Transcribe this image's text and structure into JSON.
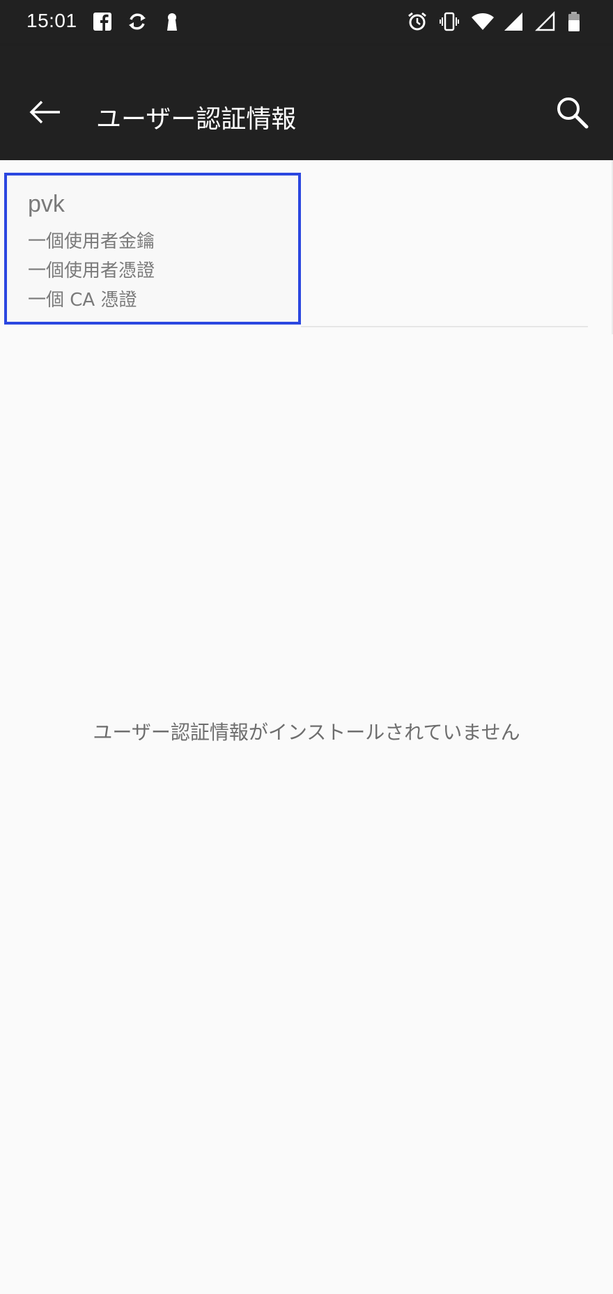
{
  "status_bar": {
    "time": "15:01",
    "left_icons": [
      "facebook-icon",
      "sync-icon",
      "keyhole-icon"
    ],
    "right_icons": [
      "alarm-icon",
      "vibrate-icon",
      "wifi-icon",
      "signal-icon",
      "signal-empty-icon",
      "battery-icon"
    ]
  },
  "app_bar": {
    "title": "ユーザー認証情報",
    "back_icon": "arrow-left-icon",
    "search_icon": "search-icon"
  },
  "credential": {
    "name": "pvk",
    "lines": [
      "一個使用者金鑰",
      "一個使用者憑證",
      "一個 CA 憑證"
    ],
    "highlight_color": "#2b47e0"
  },
  "empty_state": {
    "message": "ユーザー認証情報がインストールされていません"
  },
  "colors": {
    "bar_background": "#212121",
    "content_background": "#fafafa",
    "secondary_text": "#7a7a7a"
  }
}
